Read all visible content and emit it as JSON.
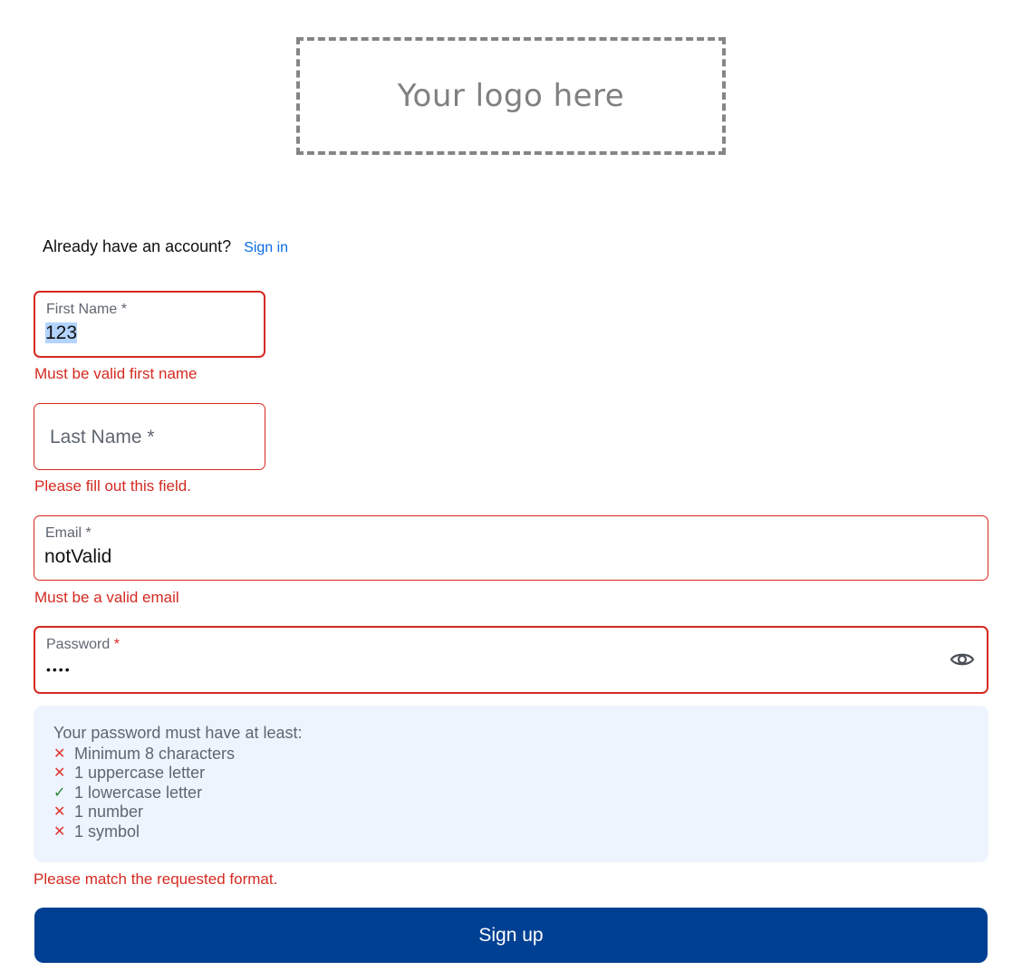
{
  "logo": {
    "text": "Your logo here"
  },
  "account": {
    "prompt": "Already have an account?",
    "signin_label": "Sign in"
  },
  "fields": {
    "first_name": {
      "label": "First Name",
      "required_mark": "*",
      "value": "123",
      "error": "Must be valid first name"
    },
    "last_name": {
      "label": "Last Name",
      "required_mark": "*",
      "value": "",
      "error": "Please fill out this field."
    },
    "email": {
      "label": "Email",
      "required_mark": "*",
      "value": "notValid",
      "error": "Must be a valid email"
    },
    "password": {
      "label": "Password",
      "required_mark": "*",
      "value_masked": "••••",
      "toggle_icon": "eye-icon",
      "error": "Please match the requested format."
    }
  },
  "password_rules": {
    "title": "Your password must have at least:",
    "items": [
      {
        "label": "Minimum 8 characters",
        "status": "fail",
        "mark": "✕"
      },
      {
        "label": "1 uppercase letter",
        "status": "fail",
        "mark": "✕"
      },
      {
        "label": "1 lowercase letter",
        "status": "pass",
        "mark": "✓"
      },
      {
        "label": "1 number",
        "status": "fail",
        "mark": "✕"
      },
      {
        "label": "1 symbol",
        "status": "fail",
        "mark": "✕"
      }
    ]
  },
  "submit": {
    "label": "Sign up"
  },
  "colors": {
    "error": "#d52a21",
    "link": "#0a6ee6",
    "primary": "#004093",
    "rules_bg": "#edf4fe",
    "pass": "#1f8a2f"
  }
}
